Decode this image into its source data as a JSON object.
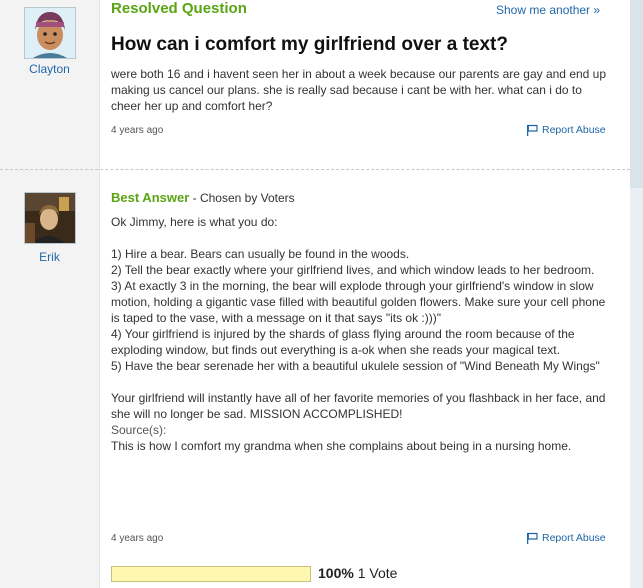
{
  "question": {
    "status": "Resolved Question",
    "show_another": "Show me another »",
    "title": "How can i comfort my girlfriend over a text?",
    "body": "were both 16 and i havent seen her in about a week because our parents are gay and end up making us cancel our plans. she is really sad because i cant be with her. what can i do to cheer her up and comfort her?",
    "timestamp": "4 years ago",
    "report_abuse": "Report Abuse",
    "asker": "Clayton"
  },
  "answer": {
    "label": "Best Answer",
    "chosen_by": " - Chosen by Voters",
    "answerer": "Erik",
    "paragraphs": [
      "Ok Jimmy, here is what you do:",
      "",
      "1) Hire a bear. Bears can usually be found in the woods.",
      "2) Tell the bear exactly where your girlfriend lives, and which window leads to her bedroom.",
      "3) At exactly 3 in the morning, the bear will explode through your girlfriend's window in slow motion, holding a gigantic vase filled with beautiful golden flowers. Make sure your cell phone is taped to the vase, with a message on it that says \"its ok :)))\"",
      "4) Your girlfriend is injured by the shards of glass flying around the room because of the exploding window, but finds out everything is a-ok when she reads your magical text.",
      "5) Have the bear serenade her with a beautiful ukulele session of \"Wind Beneath My Wings\"",
      "",
      "Your girlfriend will instantly have all of her favorite memories of you flashback in her face, and she will no longer be sad. MISSION ACCOMPLISHED!"
    ],
    "source_label": "Source(s):",
    "source_text": "This is how I comfort my grandma when she complains about being in a nursing home.",
    "timestamp": "4 years ago",
    "report_abuse": "Report Abuse",
    "vote_percent": "100%",
    "vote_count": "1 Vote",
    "vote_fraction": 1.0
  },
  "colors": {
    "accent_green": "#5aa513",
    "link_blue": "#2167a8",
    "vote_bar": "#fdf7b0"
  }
}
